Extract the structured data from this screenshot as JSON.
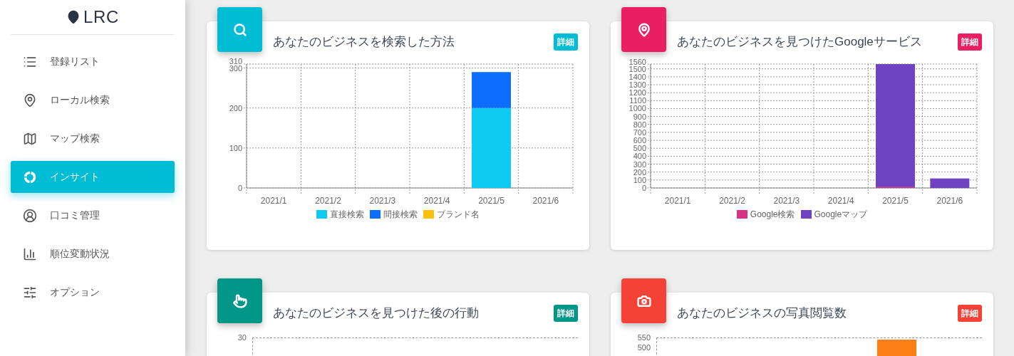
{
  "sidebar": {
    "logo": "LRC",
    "items": [
      {
        "label": "登録リスト",
        "selected": false
      },
      {
        "label": "ローカル検索",
        "selected": false
      },
      {
        "label": "マップ検索",
        "selected": false
      },
      {
        "label": "インサイト",
        "selected": true
      },
      {
        "label": "口コミ管理",
        "selected": false
      },
      {
        "label": "順位変動状況",
        "selected": false
      },
      {
        "label": "オプション",
        "selected": false
      }
    ]
  },
  "cards": [
    {
      "kind": "chart",
      "color": "#00bcd4",
      "title": "あなたのビジネスを検索した方法",
      "badge": "詳細",
      "chart_data": {
        "type": "bar",
        "stacked": true,
        "grid": true,
        "legend": true,
        "categories": [
          "2021/1",
          "2021/2",
          "2021/3",
          "2021/4",
          "2021/5",
          "2021/6"
        ],
        "ylim": [
          0,
          310
        ],
        "yticks": [
          0,
          100,
          200,
          300,
          310
        ],
        "series": [
          {
            "name": "直接検索",
            "color": "#0dcaf0",
            "values": [
              0,
              0,
              0,
              0,
              200,
              0
            ]
          },
          {
            "name": "間接検索",
            "color": "#0d6efd",
            "values": [
              0,
              0,
              0,
              0,
              90,
              0
            ]
          },
          {
            "name": "ブランド名",
            "color": "#ffc107",
            "values": [
              0,
              0,
              0,
              0,
              0,
              0
            ]
          }
        ]
      }
    },
    {
      "kind": "chart",
      "color": "#e91e63",
      "title": "あなたのビジネスを見つけたGoogleサービス",
      "badge": "詳細",
      "chart_data": {
        "type": "bar",
        "stacked": true,
        "grid": true,
        "legend": true,
        "categories": [
          "2021/1",
          "2021/2",
          "2021/3",
          "2021/4",
          "2021/5",
          "2021/6"
        ],
        "ylim": [
          0,
          1560
        ],
        "yticks": [
          0,
          100,
          200,
          300,
          400,
          500,
          600,
          700,
          800,
          900,
          1000,
          1100,
          1200,
          1300,
          1400,
          1500,
          1560
        ],
        "series": [
          {
            "name": "Google検索",
            "color": "#d63384",
            "values": [
              0,
              0,
              0,
              0,
              10,
              0
            ]
          },
          {
            "name": "Googleマップ",
            "color": "#6f42c1",
            "values": [
              0,
              0,
              0,
              0,
              1550,
              120
            ]
          }
        ]
      }
    },
    {
      "kind": "partial",
      "color": "#009688",
      "title": "あなたのビジネスを見つけた後の行動",
      "badge": "詳細",
      "ytick_labels": [
        "30"
      ],
      "bar_visible": false
    },
    {
      "kind": "partial",
      "color": "#f44336",
      "title": "あなたのビジネスの写真閲覧数",
      "badge": "詳細",
      "ytick_labels": [
        "550",
        "500"
      ],
      "bar_visible": true
    }
  ]
}
